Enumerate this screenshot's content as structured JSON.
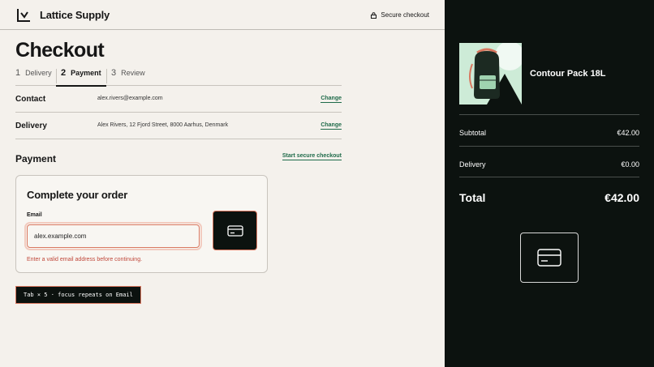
{
  "header": {
    "brand": "Lattice Supply",
    "secure_label": "Secure checkout",
    "logo_icon": "chart-logo-icon",
    "lock_icon": "lock-icon"
  },
  "page_title": "Checkout",
  "steps": [
    {
      "num": "1",
      "label": "Delivery",
      "active": false
    },
    {
      "num": "2",
      "label": "Payment",
      "active": true
    },
    {
      "num": "3",
      "label": "Review",
      "active": false
    }
  ],
  "contact": {
    "label": "Contact",
    "value": "alex.rivers@example.com",
    "link": "Change"
  },
  "delivery": {
    "label": "Delivery",
    "value": "Alex Rivers, 12 Fjord Street, 8000 Aarhus, Denmark",
    "link": "Change"
  },
  "payment": {
    "heading": "Payment",
    "start_link": "Start secure checkout"
  },
  "card": {
    "title": "Complete your order",
    "email_label": "Email",
    "email_value": "alex.example.com",
    "error": "Enter a valid email address before continuing.",
    "tile_icon": "credit-card-icon"
  },
  "tab_hint": "Tab × 5 · focus repeats on Email",
  "summary": {
    "product_name": "Contour Pack 18L",
    "subtotal_label": "Subtotal",
    "subtotal_value": "€42.00",
    "delivery_label": "Delivery",
    "delivery_value": "€0.00",
    "total_label": "Total",
    "total_value": "€42.00",
    "pay_icon": "credit-card-icon"
  },
  "colors": {
    "accent_green": "#1f6b4a",
    "error_red": "#c0473a",
    "dark_panel": "#0c120f",
    "background": "#f4f1ec"
  }
}
